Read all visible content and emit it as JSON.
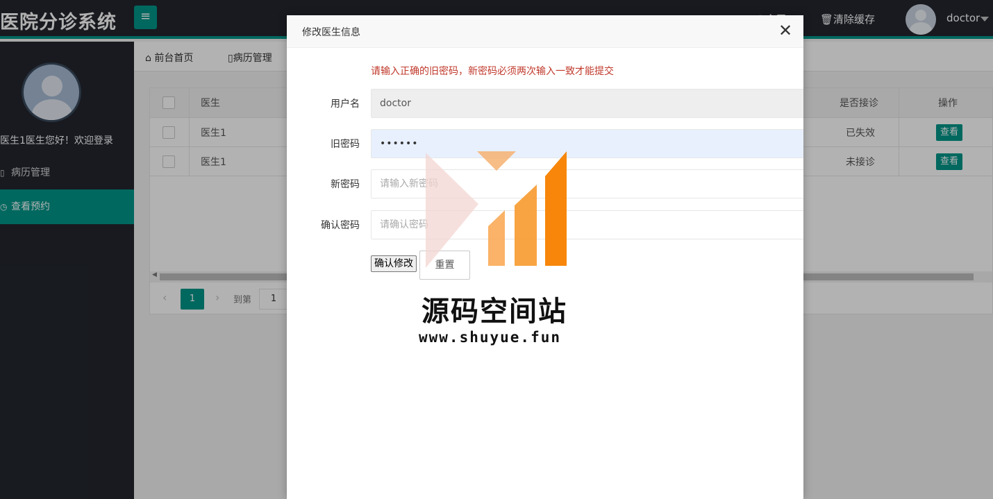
{
  "header": {
    "logo": "医院分诊系统",
    "menu_icon": "hamburger-icon",
    "fullscreen_label": "全屏",
    "clear_cache_label": "清除缓存",
    "user_name": "doctor"
  },
  "sidebar": {
    "welcome": "医生1医生您好！欢迎登录",
    "items": [
      {
        "label": "病历管理",
        "icon": "file-icon",
        "active": false
      },
      {
        "label": "查看预约",
        "icon": "clock-icon",
        "active": true
      }
    ]
  },
  "tabs": [
    {
      "label": "前台首页",
      "icon": "home-icon"
    },
    {
      "label": "病历管理",
      "icon": "file-icon"
    }
  ],
  "table": {
    "headers": [
      "医生",
      "是否接诊",
      "操作"
    ],
    "rows": [
      {
        "doctor": "医生1",
        "status": "已失效",
        "action": "查看"
      },
      {
        "doctor": "医生1",
        "status": "未接诊",
        "action": "查看"
      }
    ],
    "pager": {
      "current_page": "1",
      "goto_label": "到第",
      "goto_value": "1"
    }
  },
  "modal": {
    "title": "修改医生信息",
    "tip": "请输入正确的旧密码，新密码必须两次输入一致才能提交",
    "fields": {
      "username": {
        "label": "用户名",
        "value": "doctor"
      },
      "old_password": {
        "label": "旧密码",
        "value": "••••••"
      },
      "new_password": {
        "label": "新密码",
        "placeholder": "请输入新密码"
      },
      "confirm_password": {
        "label": "确认密码",
        "placeholder": "请确认密码"
      }
    },
    "submit_label": "确认修改",
    "reset_label": "重置"
  },
  "watermark": {
    "title": "源码空间站",
    "url": "www.shuyue.fun"
  },
  "colors": {
    "accent": "#009688",
    "sidebar_bg": "#23262e",
    "tip_red": "#c0392b",
    "wm_orange": "#f7860b"
  }
}
